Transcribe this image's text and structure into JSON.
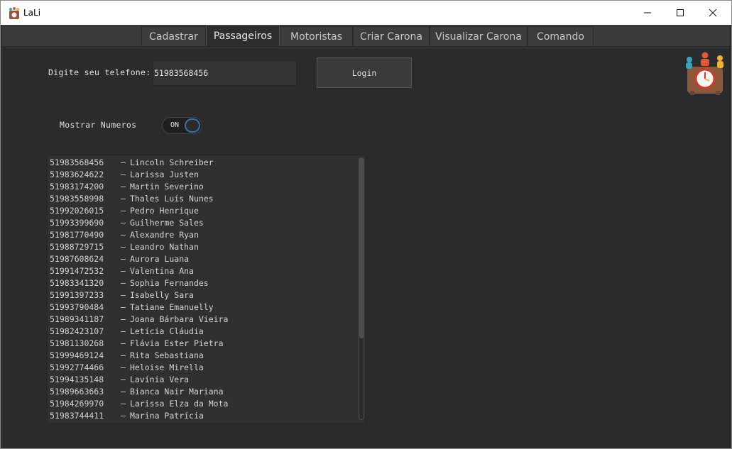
{
  "window": {
    "title": "LaLi",
    "controls": {
      "minimize": "—",
      "maximize": "☐",
      "close": "✕"
    }
  },
  "tabs": [
    {
      "label": "Cadastrar",
      "active": false
    },
    {
      "label": "Passageiros",
      "active": true
    },
    {
      "label": "Motoristas",
      "active": false
    },
    {
      "label": "Criar Carona",
      "active": false
    },
    {
      "label": "Visualizar Carona",
      "active": false
    },
    {
      "label": "Comando",
      "active": false
    }
  ],
  "login": {
    "phone_label": "Digite seu telefone:",
    "phone_value": "51983568456",
    "button_label": "Login"
  },
  "show_numbers": {
    "label": "Mostrar Numeros",
    "toggle_text": "ON",
    "state": true
  },
  "passengers": [
    {
      "phone": "51983568456",
      "name": "Lincoln Schreiber"
    },
    {
      "phone": "51983624622",
      "name": "Larissa Justen"
    },
    {
      "phone": "51983174200",
      "name": "Martin Severino"
    },
    {
      "phone": "51983558998",
      "name": "Thales Luís Nunes"
    },
    {
      "phone": "51992026015",
      "name": "Pedro Henrique"
    },
    {
      "phone": "51993399690",
      "name": "Guilherme Sales"
    },
    {
      "phone": "51981770490",
      "name": "Alexandre Ryan"
    },
    {
      "phone": "51988729715",
      "name": "Leandro Nathan"
    },
    {
      "phone": "51987608624",
      "name": "Aurora Luana"
    },
    {
      "phone": "51991472532",
      "name": "Valentina Ana"
    },
    {
      "phone": "51983341320",
      "name": "Sophia Fernandes"
    },
    {
      "phone": "51991397233",
      "name": "Isabelly Sara"
    },
    {
      "phone": "51993790484",
      "name": "Tatiane Emanuelly"
    },
    {
      "phone": "51989341187",
      "name": "Joana Bárbara Vieira"
    },
    {
      "phone": "51982423107",
      "name": "Letícia Cláudia"
    },
    {
      "phone": "51981130268",
      "name": "Flávia Ester Pietra"
    },
    {
      "phone": "51999469124",
      "name": "Rita Sebastiana"
    },
    {
      "phone": "51992774466",
      "name": "Heloise Mirella"
    },
    {
      "phone": "51994135148",
      "name": "Lavínia Vera"
    },
    {
      "phone": "51989663663",
      "name": "Bianca Nair Mariana"
    },
    {
      "phone": "51984269970",
      "name": "Larissa Elza da Mota"
    },
    {
      "phone": "51983744411",
      "name": "Marina Patrícia"
    }
  ],
  "separator": "  –",
  "colors": {
    "background": "#2b2b2d",
    "toggle_accent": "#3c6fa8",
    "text": "#e0e0e0"
  }
}
